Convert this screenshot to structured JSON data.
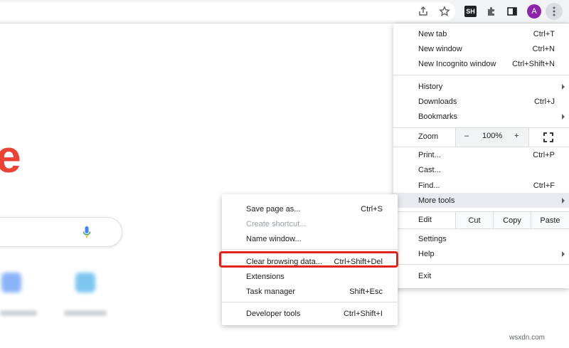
{
  "toolbar": {
    "icons": [
      "share-icon",
      "star-icon",
      "sh-extension-icon",
      "puzzle-extensions-icon",
      "side-panel-icon",
      "profile-avatar",
      "more-menu-icon"
    ],
    "sh_label": "SH",
    "avatar_letter": "A"
  },
  "background": {
    "logo_letter": "e",
    "logo_color": "#ea4335"
  },
  "menu": {
    "new_tab": {
      "label": "New tab",
      "shortcut": "Ctrl+T"
    },
    "new_window": {
      "label": "New window",
      "shortcut": "Ctrl+N"
    },
    "new_incognito": {
      "label": "New Incognito window",
      "shortcut": "Ctrl+Shift+N"
    },
    "history": {
      "label": "History"
    },
    "downloads": {
      "label": "Downloads",
      "shortcut": "Ctrl+J"
    },
    "bookmarks": {
      "label": "Bookmarks"
    },
    "zoom": {
      "label": "Zoom",
      "minus": "–",
      "value": "100%",
      "plus": "+"
    },
    "print": {
      "label": "Print...",
      "shortcut": "Ctrl+P"
    },
    "cast": {
      "label": "Cast..."
    },
    "find": {
      "label": "Find...",
      "shortcut": "Ctrl+F"
    },
    "more_tools": {
      "label": "More tools"
    },
    "edit": {
      "label": "Edit",
      "cut": "Cut",
      "copy": "Copy",
      "paste": "Paste"
    },
    "settings": {
      "label": "Settings"
    },
    "help": {
      "label": "Help"
    },
    "exit": {
      "label": "Exit"
    }
  },
  "submenu": {
    "save_page": {
      "label": "Save page as...",
      "shortcut": "Ctrl+S"
    },
    "create_shortcut": {
      "label": "Create shortcut..."
    },
    "name_window": {
      "label": "Name window..."
    },
    "clear_data": {
      "label": "Clear browsing data...",
      "shortcut": "Ctrl+Shift+Del"
    },
    "extensions": {
      "label": "Extensions"
    },
    "task_manager": {
      "label": "Task manager",
      "shortcut": "Shift+Esc"
    },
    "dev_tools": {
      "label": "Developer tools",
      "shortcut": "Ctrl+Shift+I"
    }
  },
  "highlight_color": "#e0241b",
  "watermark": "wsxdn.com"
}
